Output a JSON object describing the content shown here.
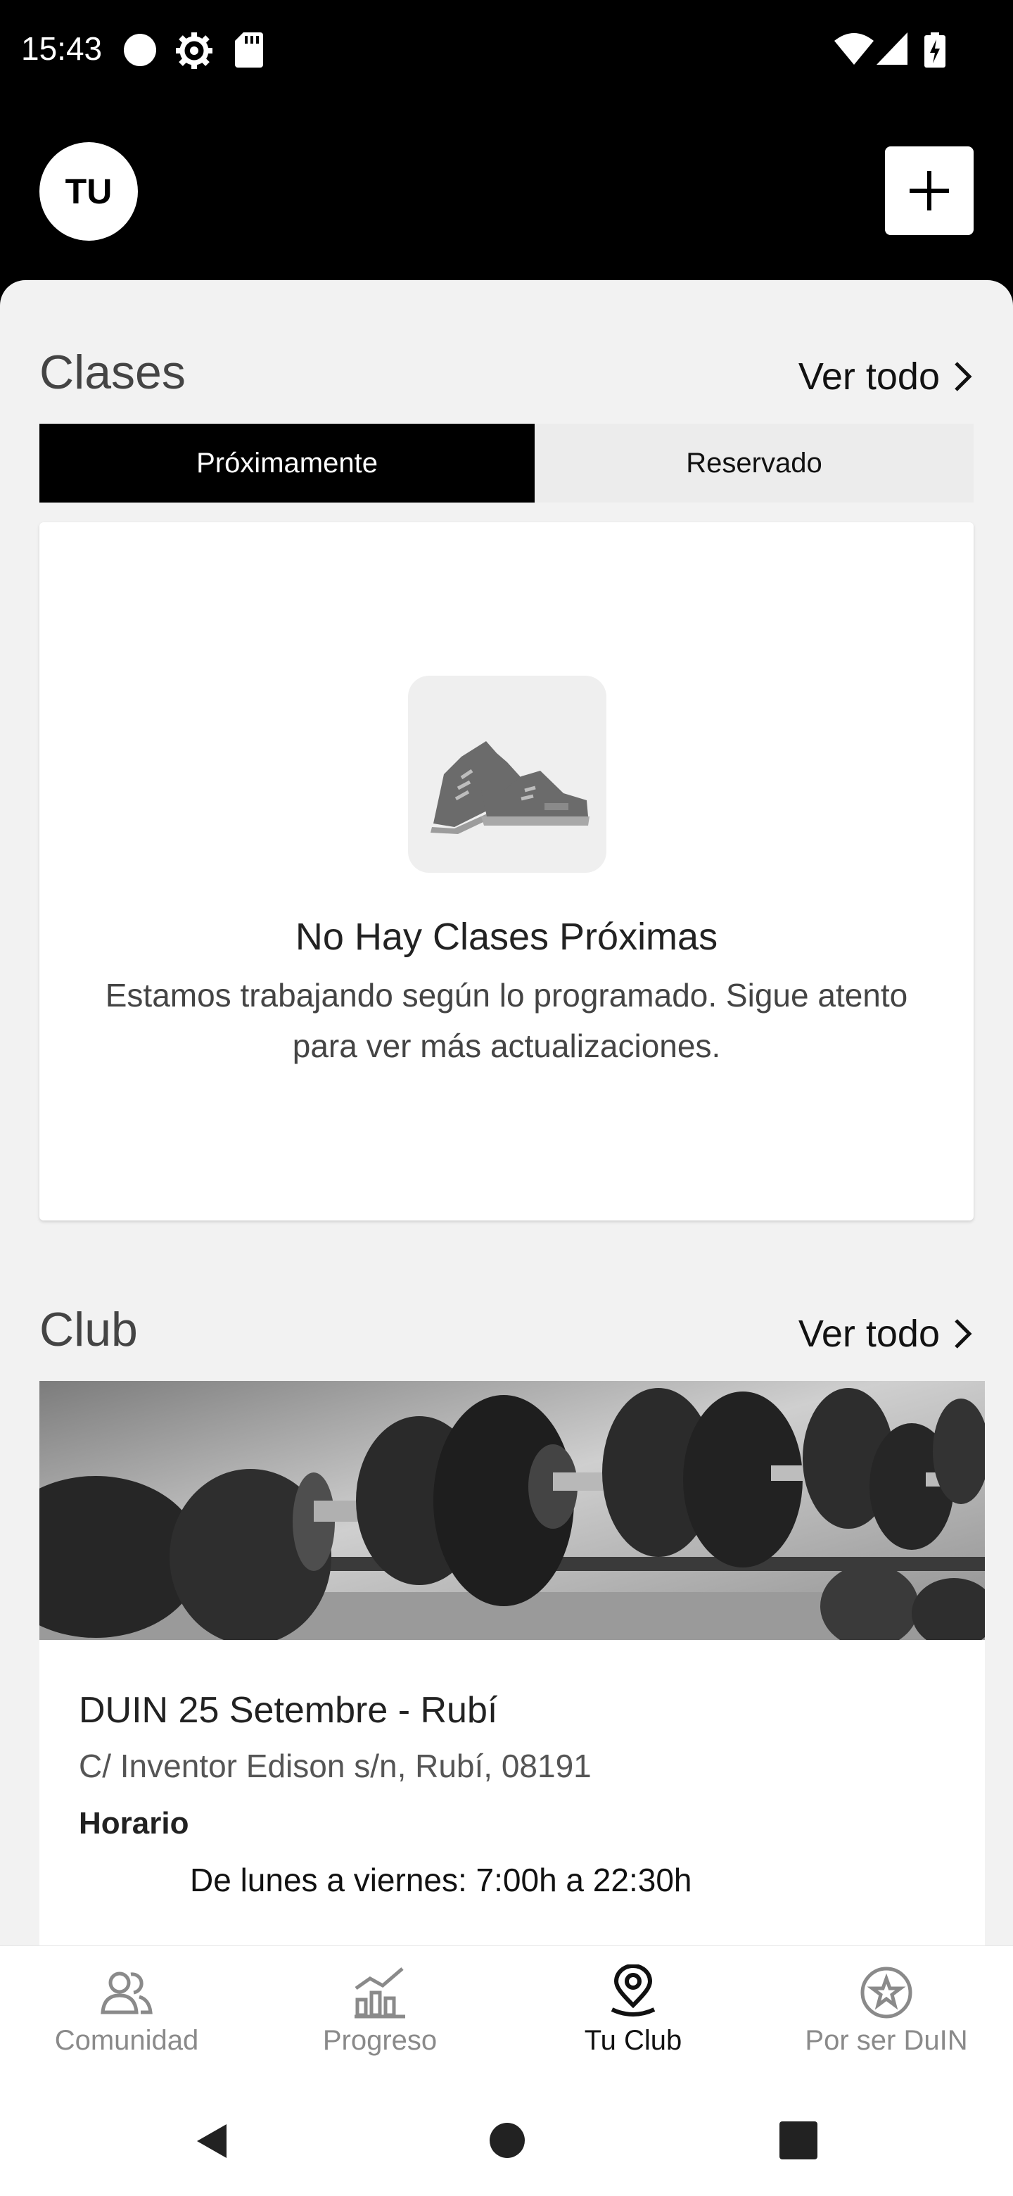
{
  "status_bar": {
    "time": "15:43",
    "icons": [
      "circle-icon",
      "settings-icon",
      "sd-card-icon",
      "wifi-icon",
      "signal-icon",
      "battery-charging-icon"
    ]
  },
  "header": {
    "avatar_initials": "TU",
    "add_icon": "plus-icon"
  },
  "classes": {
    "title": "Clases",
    "see_all": "Ver todo",
    "tabs": [
      {
        "label": "Próximamente",
        "active": true
      },
      {
        "label": "Reservado",
        "active": false
      }
    ],
    "empty_state": {
      "icon": "sneakers-icon",
      "title": "No Hay Clases Próximas",
      "text": "Estamos trabajando según lo programado. Sigue atento para ver más actualizaciones."
    }
  },
  "club": {
    "title": "Club",
    "see_all": "Ver todo",
    "image": "dumbbells-photo",
    "name": "DUIN 25 Setembre - Rubí",
    "address": "C/ Inventor Edison s/n, Rubí,  08191",
    "hours_label": "Horario",
    "hours": "De lunes a viernes: 7:00h a 22:30h"
  },
  "bottom_nav": {
    "items": [
      {
        "label": "Comunidad",
        "icon": "community-icon",
        "active": false
      },
      {
        "label": "Progreso",
        "icon": "progress-chart-icon",
        "active": false
      },
      {
        "label": "Tu Club",
        "icon": "location-pin-icon",
        "active": true
      },
      {
        "label": "Por ser DuIN",
        "icon": "star-badge-icon",
        "active": false
      }
    ]
  },
  "system_nav": [
    "back-icon",
    "home-icon",
    "recents-icon"
  ],
  "colors": {
    "header_bg": "#000000",
    "content_bg": "#f2f2f2",
    "active_tab": "#000000",
    "inactive_nav": "#8a8a8a"
  }
}
